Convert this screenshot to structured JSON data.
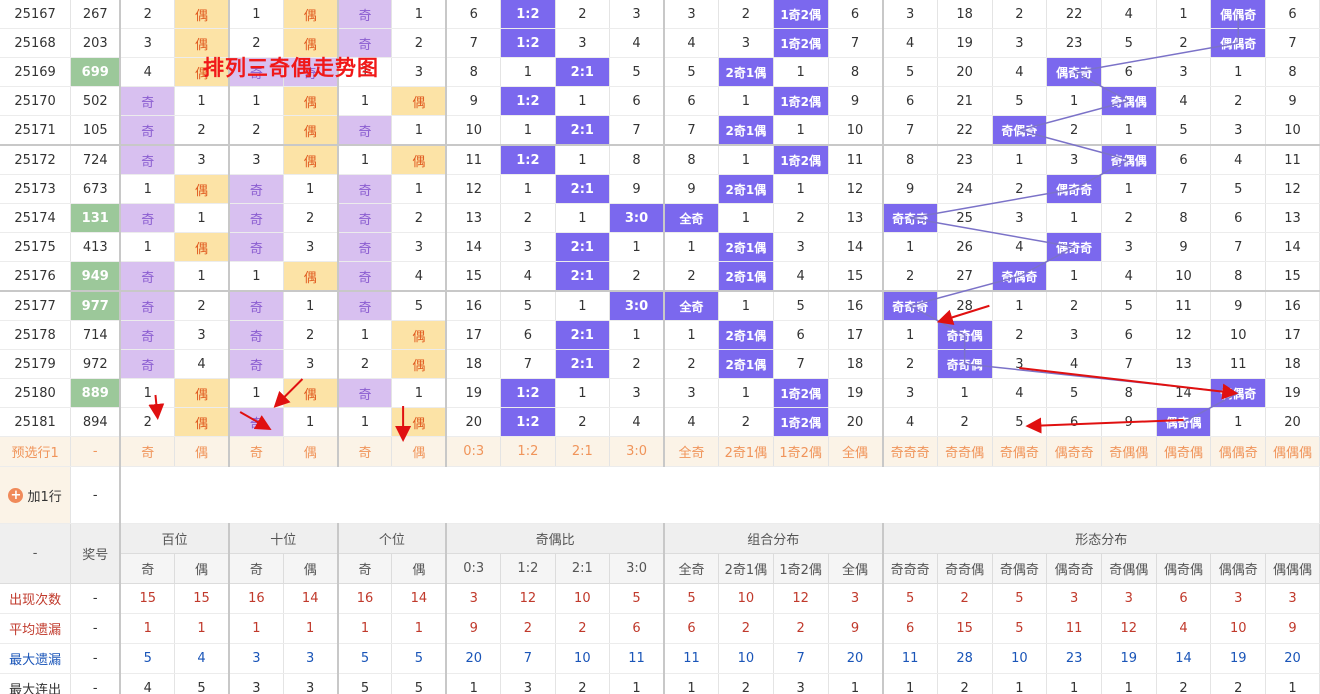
{
  "title_overlay": "排列三奇偶走势图",
  "rows": [
    {
      "issue": "25167",
      "num": "267",
      "green": false,
      "c": [
        "2",
        "偶",
        "1",
        "偶",
        "奇",
        "1",
        "6",
        "1:2",
        "2",
        "3",
        "3",
        "2",
        "1奇2偶",
        "6",
        "3",
        "18",
        "2",
        "22",
        "4",
        "1",
        "偶偶奇",
        "6"
      ]
    },
    {
      "issue": "25168",
      "num": "203",
      "green": false,
      "c": [
        "3",
        "偶",
        "2",
        "偶",
        "奇",
        "2",
        "7",
        "1:2",
        "3",
        "4",
        "4",
        "3",
        "1奇2偶",
        "7",
        "4",
        "19",
        "3",
        "23",
        "5",
        "2",
        "偶偶奇",
        "7"
      ]
    },
    {
      "issue": "25169",
      "num": "699",
      "green": true,
      "c": [
        "4",
        "偶",
        "奇",
        "奇",
        "1",
        "3",
        "8",
        "1",
        "2:1",
        "5",
        "5",
        "2奇1偶",
        "1",
        "8",
        "5",
        "20",
        "4",
        "偶奇奇",
        "6",
        "3",
        "1",
        "8"
      ]
    },
    {
      "issue": "25170",
      "num": "502",
      "green": false,
      "c": [
        "奇",
        "1",
        "1",
        "偶",
        "1",
        "偶",
        "9",
        "1:2",
        "1",
        "6",
        "6",
        "1",
        "1奇2偶",
        "9",
        "6",
        "21",
        "5",
        "1",
        "奇偶偶",
        "4",
        "2",
        "9"
      ]
    },
    {
      "issue": "25171",
      "num": "105",
      "green": false,
      "c": [
        "奇",
        "2",
        "2",
        "偶",
        "奇",
        "1",
        "10",
        "1",
        "2:1",
        "7",
        "7",
        "2奇1偶",
        "1",
        "10",
        "7",
        "22",
        "奇偶奇",
        "2",
        "1",
        "5",
        "3",
        "10"
      ]
    },
    {
      "issue": "25172",
      "num": "724",
      "green": false,
      "c": [
        "奇",
        "3",
        "3",
        "偶",
        "1",
        "偶",
        "11",
        "1:2",
        "1",
        "8",
        "8",
        "1",
        "1奇2偶",
        "11",
        "8",
        "23",
        "1",
        "3",
        "奇偶偶",
        "6",
        "4",
        "11"
      ]
    },
    {
      "issue": "25173",
      "num": "673",
      "green": false,
      "c": [
        "1",
        "偶",
        "奇",
        "1",
        "奇",
        "1",
        "12",
        "1",
        "2:1",
        "9",
        "9",
        "2奇1偶",
        "1",
        "12",
        "9",
        "24",
        "2",
        "偶奇奇",
        "1",
        "7",
        "5",
        "12"
      ]
    },
    {
      "issue": "25174",
      "num": "131",
      "green": true,
      "c": [
        "奇",
        "1",
        "奇",
        "2",
        "奇",
        "2",
        "13",
        "2",
        "1",
        "3:0",
        "全奇",
        "1",
        "2",
        "13",
        "奇奇奇",
        "25",
        "3",
        "1",
        "2",
        "8",
        "6",
        "13"
      ]
    },
    {
      "issue": "25175",
      "num": "413",
      "green": false,
      "c": [
        "1",
        "偶",
        "奇",
        "3",
        "奇",
        "3",
        "14",
        "3",
        "2:1",
        "1",
        "1",
        "2奇1偶",
        "3",
        "14",
        "1",
        "26",
        "4",
        "偶奇奇",
        "3",
        "9",
        "7",
        "14"
      ]
    },
    {
      "issue": "25176",
      "num": "949",
      "green": true,
      "c": [
        "奇",
        "1",
        "1",
        "偶",
        "奇",
        "4",
        "15",
        "4",
        "2:1",
        "2",
        "2",
        "2奇1偶",
        "4",
        "15",
        "2",
        "27",
        "奇偶奇",
        "1",
        "4",
        "10",
        "8",
        "15"
      ]
    },
    {
      "issue": "25177",
      "num": "977",
      "green": true,
      "c": [
        "奇",
        "2",
        "奇",
        "1",
        "奇",
        "5",
        "16",
        "5",
        "1",
        "3:0",
        "全奇",
        "1",
        "5",
        "16",
        "奇奇奇",
        "28",
        "1",
        "2",
        "5",
        "11",
        "9",
        "16"
      ]
    },
    {
      "issue": "25178",
      "num": "714",
      "green": false,
      "c": [
        "奇",
        "3",
        "奇",
        "2",
        "1",
        "偶",
        "17",
        "6",
        "2:1",
        "1",
        "1",
        "2奇1偶",
        "6",
        "17",
        "1",
        "奇奇偶",
        "2",
        "3",
        "6",
        "12",
        "10",
        "17"
      ]
    },
    {
      "issue": "25179",
      "num": "972",
      "green": false,
      "c": [
        "奇",
        "4",
        "奇",
        "3",
        "2",
        "偶",
        "18",
        "7",
        "2:1",
        "2",
        "2",
        "2奇1偶",
        "7",
        "18",
        "2",
        "奇奇偶",
        "3",
        "4",
        "7",
        "13",
        "11",
        "18"
      ]
    },
    {
      "issue": "25180",
      "num": "889",
      "green": true,
      "c": [
        "1",
        "偶",
        "1",
        "偶",
        "奇",
        "1",
        "19",
        "1:2",
        "1",
        "3",
        "3",
        "1",
        "1奇2偶",
        "19",
        "3",
        "1",
        "4",
        "5",
        "8",
        "14",
        "偶偶奇",
        "19"
      ]
    },
    {
      "issue": "25181",
      "num": "894",
      "green": false,
      "c": [
        "2",
        "偶",
        "奇",
        "1",
        "1",
        "偶",
        "20",
        "1:2",
        "2",
        "4",
        "4",
        "2",
        "1奇2偶",
        "20",
        "4",
        "2",
        "5",
        "6",
        "9",
        "偶奇偶",
        "1",
        "20"
      ]
    }
  ],
  "preselect": {
    "label": "预选行1",
    "dash": "-",
    "cells": [
      "奇",
      "偶",
      "奇",
      "偶",
      "奇",
      "偶",
      "0:3",
      "1:2",
      "2:1",
      "3:0",
      "全奇",
      "2奇1偶",
      "1奇2偶",
      "全偶",
      "奇奇奇",
      "奇奇偶",
      "奇偶奇",
      "偶奇奇",
      "奇偶偶",
      "偶奇偶",
      "偶偶奇",
      "偶偶偶"
    ]
  },
  "add_row": {
    "label": "加1行",
    "dash": "-"
  },
  "header": {
    "dash": "-",
    "prize": "奖号",
    "groups": [
      "百位",
      "十位",
      "个位",
      "奇偶比",
      "组合分布",
      "形态分布"
    ],
    "sub": [
      "奇",
      "偶",
      "奇",
      "偶",
      "奇",
      "偶",
      "0:3",
      "1:2",
      "2:1",
      "3:0",
      "全奇",
      "2奇1偶",
      "1奇2偶",
      "全偶",
      "奇奇奇",
      "奇奇偶",
      "奇偶奇",
      "偶奇奇",
      "奇偶偶",
      "偶奇偶",
      "偶偶奇",
      "偶偶偶"
    ]
  },
  "stats": [
    {
      "label": "出现次数",
      "dash": "-",
      "style": "red",
      "v": [
        "15",
        "15",
        "16",
        "14",
        "16",
        "14",
        "3",
        "12",
        "10",
        "5",
        "5",
        "10",
        "12",
        "3",
        "5",
        "2",
        "5",
        "3",
        "3",
        "6",
        "3",
        "3"
      ]
    },
    {
      "label": "平均遗漏",
      "dash": "-",
      "style": "red",
      "v": [
        "1",
        "1",
        "1",
        "1",
        "1",
        "1",
        "9",
        "2",
        "2",
        "6",
        "6",
        "2",
        "2",
        "9",
        "6",
        "15",
        "5",
        "11",
        "12",
        "4",
        "10",
        "9"
      ]
    },
    {
      "label": "最大遗漏",
      "dash": "-",
      "style": "blue",
      "v": [
        "5",
        "4",
        "3",
        "3",
        "5",
        "5",
        "20",
        "7",
        "10",
        "11",
        "11",
        "10",
        "7",
        "20",
        "11",
        "28",
        "10",
        "23",
        "19",
        "14",
        "19",
        "20"
      ]
    },
    {
      "label": "最大连出",
      "dash": "-",
      "style": "black",
      "v": [
        "4",
        "5",
        "3",
        "3",
        "5",
        "5",
        "1",
        "3",
        "2",
        "1",
        "1",
        "2",
        "3",
        "1",
        "1",
        "2",
        "1",
        "1",
        "1",
        "2",
        "2",
        "1"
      ]
    }
  ]
}
